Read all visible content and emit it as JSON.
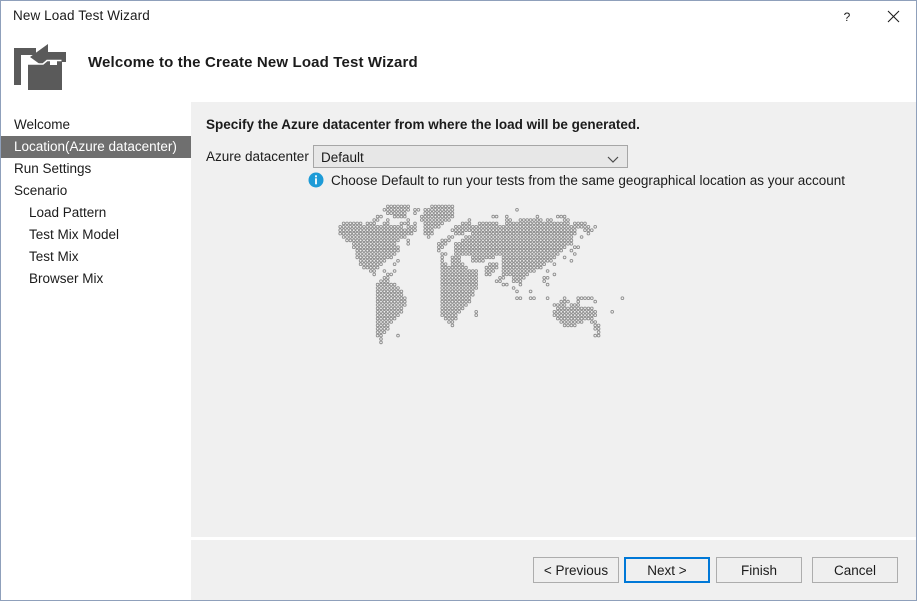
{
  "window": {
    "title": "New Load Test Wizard",
    "help_icon": "question-mark-icon",
    "close_icon": "close-icon"
  },
  "header": {
    "icon": "new-project-folder-arrow-icon",
    "title": "Welcome to the Create New Load Test Wizard"
  },
  "sidebar": {
    "items": [
      {
        "label": "Welcome",
        "selected": false,
        "indented": false
      },
      {
        "label": "Location(Azure datacenter)",
        "selected": true,
        "indented": false
      },
      {
        "label": "Run Settings",
        "selected": false,
        "indented": false
      },
      {
        "label": "Scenario",
        "selected": false,
        "indented": false
      },
      {
        "label": "Load Pattern",
        "selected": false,
        "indented": true
      },
      {
        "label": "Test Mix Model",
        "selected": false,
        "indented": true
      },
      {
        "label": "Test Mix",
        "selected": false,
        "indented": true
      },
      {
        "label": "Browser Mix",
        "selected": false,
        "indented": true
      }
    ]
  },
  "main": {
    "heading": "Specify the Azure datacenter from where the load will be generated.",
    "field_label": "Azure datacenter",
    "datacenter": {
      "selected": "Default",
      "chevron_icon": "chevron-down-icon"
    },
    "hint": {
      "icon": "info-icon",
      "text": "Choose Default to run your tests from the same geographical location as your account"
    },
    "map": {
      "name": "world-map-dotted",
      "dot_color": "#8f8f8f"
    }
  },
  "footer": {
    "buttons": [
      {
        "label": "< Previous",
        "focused": false
      },
      {
        "label": "Next >",
        "focused": true
      },
      {
        "label": "Finish",
        "focused": false
      },
      {
        "label": "Cancel",
        "focused": false
      }
    ]
  },
  "colors": {
    "accent": "#0078d7",
    "window_border": "#8fa0bb",
    "panel_bg": "#f0f0f0",
    "selected_nav_bg": "#6f6f6f",
    "icon_gray": "#5a5a5a",
    "info_blue": "#1d9bd7"
  }
}
